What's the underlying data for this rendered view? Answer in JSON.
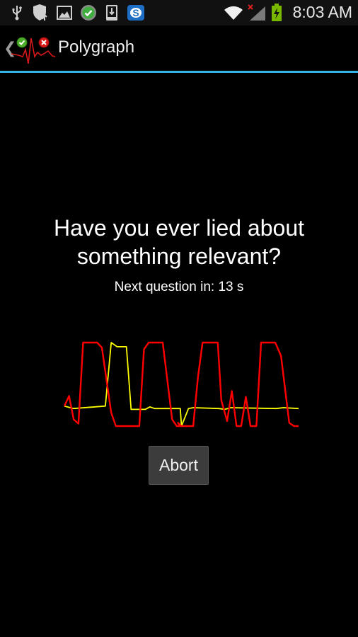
{
  "status_bar": {
    "left_icons": [
      "usb-icon",
      "security-shield-icon",
      "gallery-icon",
      "check-circle-icon",
      "download-icon",
      "skype-icon"
    ],
    "right_icons": [
      "wifi-icon",
      "no-signal-icon",
      "battery-charging-icon"
    ],
    "time": "8:03 AM"
  },
  "action_bar": {
    "title": "Polygraph",
    "accent_color": "#33b5e5"
  },
  "main": {
    "question": "Have you ever lied about something relevant?",
    "countdown_label": "Next question in: 13 s",
    "seconds_remaining": 13,
    "abort_label": "Abort"
  },
  "chart_data": {
    "type": "line",
    "title": "",
    "xlabel": "",
    "ylabel": "",
    "ylim": [
      0,
      100
    ],
    "grid": false,
    "legend": "none",
    "series": [
      {
        "name": "red-trace",
        "color": "#ff0000",
        "points": [
          [
            0,
            24
          ],
          [
            2,
            36
          ],
          [
            4,
            8
          ],
          [
            6,
            3
          ],
          [
            8,
            100
          ],
          [
            14,
            100
          ],
          [
            16,
            94
          ],
          [
            20,
            16
          ],
          [
            22,
            0
          ],
          [
            32,
            0
          ],
          [
            34,
            92
          ],
          [
            36,
            100
          ],
          [
            42,
            100
          ],
          [
            46,
            8
          ],
          [
            48,
            0
          ],
          [
            50,
            0
          ],
          [
            48.5,
            4
          ],
          [
            49.5,
            0
          ],
          [
            55,
            0
          ],
          [
            57,
            58
          ],
          [
            59,
            100
          ],
          [
            65.5,
            100
          ],
          [
            67,
            31
          ],
          [
            69.5,
            6
          ],
          [
            71.5,
            42
          ],
          [
            73.5,
            0
          ],
          [
            75.5,
            0
          ],
          [
            77.5,
            35
          ],
          [
            79.5,
            0
          ],
          [
            82,
            0
          ],
          [
            84,
            100
          ],
          [
            90,
            100
          ],
          [
            90.5,
            97
          ],
          [
            92.5,
            84
          ],
          [
            96,
            4
          ],
          [
            98,
            0
          ],
          [
            100,
            0
          ]
        ]
      },
      {
        "name": "yellow-trace",
        "color": "#ffff00",
        "points": [
          [
            0,
            24
          ],
          [
            4,
            21
          ],
          [
            17.5,
            24
          ],
          [
            20,
            100
          ],
          [
            22.5,
            95
          ],
          [
            26.5,
            95
          ],
          [
            28.5,
            20
          ],
          [
            34.5,
            20
          ],
          [
            36.5,
            23
          ],
          [
            38.5,
            21
          ],
          [
            48.5,
            21
          ],
          [
            49.5,
            21
          ],
          [
            50,
            0
          ],
          [
            53,
            21
          ],
          [
            55,
            22
          ],
          [
            66,
            21
          ],
          [
            68.5,
            20
          ],
          [
            71,
            22
          ],
          [
            90.5,
            21
          ],
          [
            93.5,
            22
          ],
          [
            100,
            21
          ]
        ]
      }
    ]
  }
}
